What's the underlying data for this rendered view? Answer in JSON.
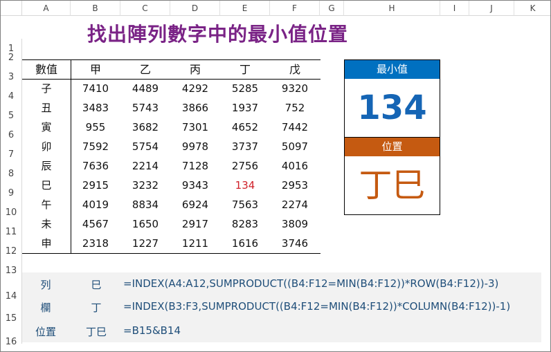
{
  "columns": [
    "A",
    "B",
    "C",
    "D",
    "E",
    "F",
    "G",
    "H",
    "I",
    "J",
    "K"
  ],
  "rows": [
    "1",
    "2",
    "3",
    "4",
    "5",
    "6",
    "7",
    "8",
    "9",
    "10",
    "11",
    "12",
    "13",
    "14",
    "15",
    "16"
  ],
  "title": "找出陣列數字中的最小值位置",
  "table": {
    "corner_label": "數值",
    "headers": [
      "甲",
      "乙",
      "丙",
      "丁",
      "戊"
    ],
    "row_labels": [
      "子",
      "丑",
      "寅",
      "卯",
      "辰",
      "巳",
      "午",
      "未",
      "申"
    ],
    "values": [
      [
        "7410",
        "4489",
        "4292",
        "5285",
        "9320"
      ],
      [
        "3483",
        "5743",
        "3866",
        "1937",
        "752"
      ],
      [
        "955",
        "3682",
        "7301",
        "4652",
        "7442"
      ],
      [
        "7592",
        "5754",
        "9978",
        "3737",
        "5097"
      ],
      [
        "7636",
        "2214",
        "7128",
        "2756",
        "4016"
      ],
      [
        "2915",
        "3232",
        "9343",
        "134",
        "2953"
      ],
      [
        "4019",
        "8834",
        "6924",
        "7563",
        "2274"
      ],
      [
        "4567",
        "1650",
        "2917",
        "8283",
        "3809"
      ],
      [
        "2318",
        "1227",
        "1211",
        "1616",
        "3746"
      ]
    ],
    "highlight": {
      "row": 5,
      "col": 3,
      "color": "#d0212a"
    }
  },
  "min_box": {
    "label": "最小值",
    "value": "134",
    "header_color": "#0070c0",
    "value_color": "#1565b5"
  },
  "pos_box": {
    "label": "位置",
    "value": "丁巳",
    "header_color": "#c55a11",
    "value_color": "#c55a11"
  },
  "formulas": [
    {
      "label": "列",
      "value": "巳",
      "formula": "=INDEX(A4:A12,SUMPRODUCT((B4:F12=MIN(B4:F12))*ROW(B4:F12))-3)"
    },
    {
      "label": "欄",
      "value": "丁",
      "formula": "=INDEX(B3:F3,SUMPRODUCT((B4:F12=MIN(B4:F12))*COLUMN(B4:F12))-1)"
    },
    {
      "label": "位置",
      "value": "丁巳",
      "formula": "=B15&B14"
    }
  ]
}
